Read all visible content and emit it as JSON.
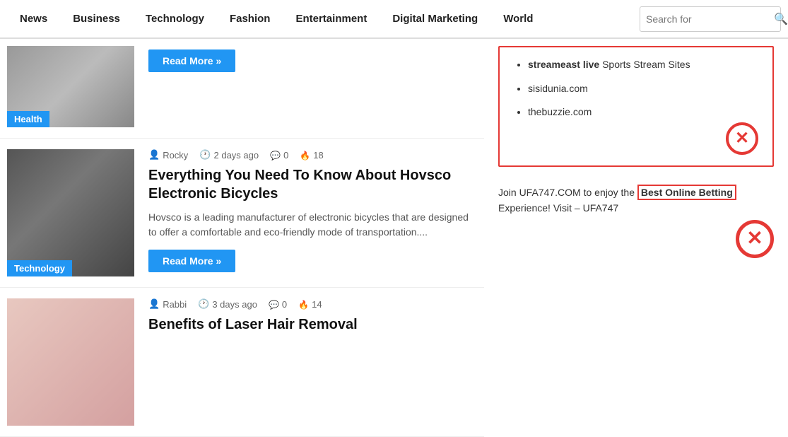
{
  "nav": {
    "items": [
      {
        "label": "News",
        "active": false
      },
      {
        "label": "Business",
        "active": false
      },
      {
        "label": "Technology",
        "active": false
      },
      {
        "label": "Fashion",
        "active": false
      },
      {
        "label": "Entertainment",
        "active": false
      },
      {
        "label": "Digital Marketing",
        "active": false
      },
      {
        "label": "World",
        "active": false
      }
    ],
    "search_placeholder": "Search for"
  },
  "articles": [
    {
      "id": "article-health",
      "category": "Health",
      "category_class": "badge-health",
      "thumb_class": "thumb-health",
      "read_more": "Read More »",
      "partial": true
    },
    {
      "id": "article-bicycles",
      "category": "Technology",
      "category_class": "badge-technology",
      "thumb_class": "thumb-tech",
      "author": "Rocky",
      "time_ago": "2 days ago",
      "comments": "0",
      "fires": "18",
      "title": "Everything You Need To Know About Hovsco Electronic Bicycles",
      "excerpt": "Hovsco is a leading manufacturer of electronic bicycles that are designed to offer a comfortable and eco-friendly mode of transportation....",
      "read_more": "Read More »",
      "partial": false
    },
    {
      "id": "article-laser",
      "category": "",
      "category_class": "",
      "thumb_class": "thumb-laser",
      "author": "Rabbi",
      "time_ago": "3 days ago",
      "comments": "0",
      "fires": "14",
      "title": "Benefits of Laser Hair Removal",
      "excerpt": "",
      "read_more": "",
      "partial": true,
      "bottom": true
    }
  ],
  "sidebar": {
    "links": [
      {
        "text_bold": "streameast live",
        "text_normal": " Sports Stream Sites"
      },
      {
        "text_bold": "",
        "text_normal": "sisidunia.com"
      },
      {
        "text_bold": "",
        "text_normal": "thebuzzie.com"
      }
    ],
    "betting_text": "Join UFA747.COM to enjoy the",
    "betting_highlight": "Best Online Betting",
    "betting_text2": "Experience! Visit – UFA747"
  }
}
